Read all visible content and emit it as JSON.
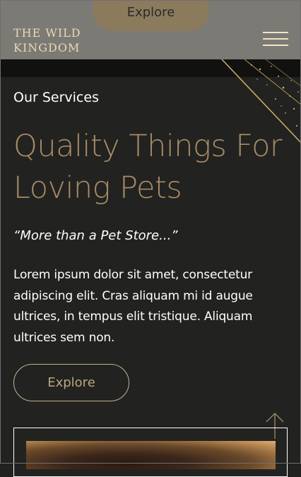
{
  "header": {
    "explore_label": "Explore",
    "logo_line1": "THE WILD",
    "logo_line2": "KINGDOM",
    "menu_icon": "hamburger-menu-icon"
  },
  "hero": {
    "subheading": "Our Services",
    "title": "Quality Things For Loving Pets",
    "quote": "“More than a Pet Store...”",
    "body": "Lorem ipsum dolor sit amet, consectetur adipiscing elit. Cras aliquam mi id augue ultrices, in tempus elit tristique. Aliquam ultrices sem non.",
    "explore_label": "Explore"
  },
  "icons": {
    "scroll": "arrow-up-icon",
    "decoration": "sparkle-lines"
  },
  "colors": {
    "background": "#222220",
    "header": "#7c7a75",
    "gold": "#a68c66",
    "button_fill": "#8c7a5d"
  }
}
